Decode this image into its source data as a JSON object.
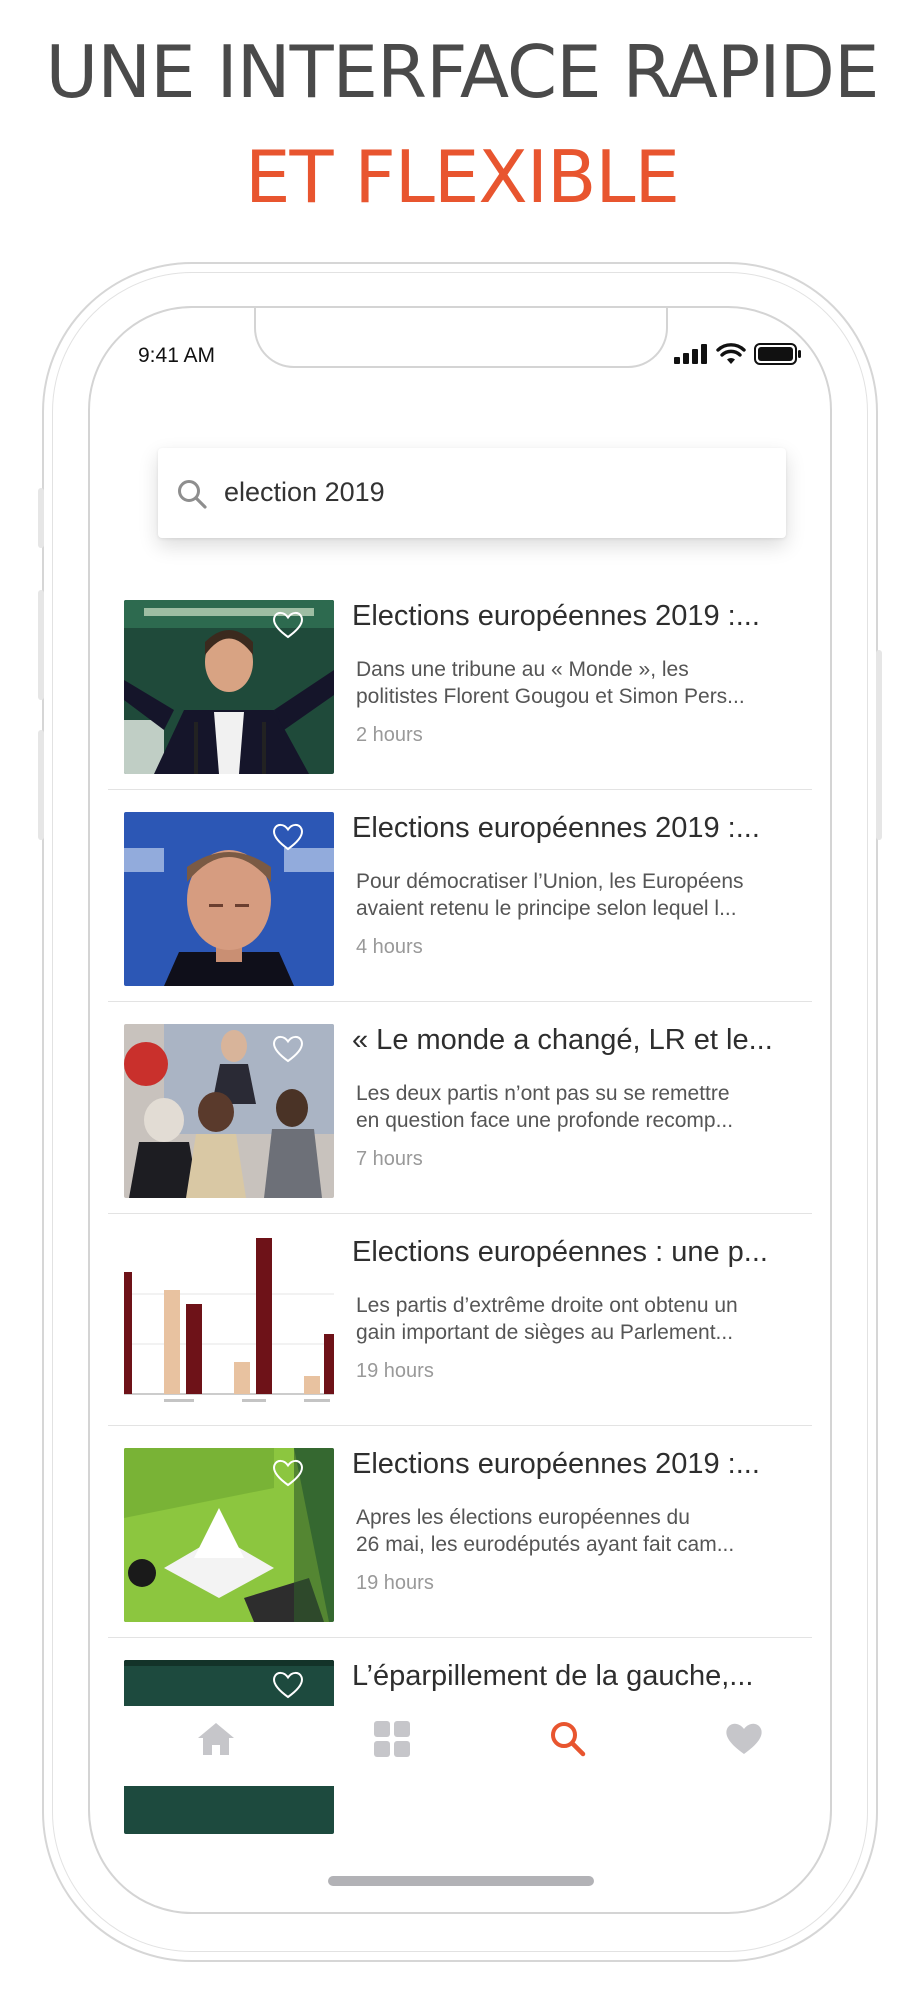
{
  "headline": {
    "line1": "UNE INTERFACE RAPIDE",
    "line2": "ET FLEXIBLE"
  },
  "colors": {
    "accent": "#e8552f",
    "text": "#4a4a4a",
    "inactive_icon": "#c6c6ca"
  },
  "status_bar": {
    "time": "9:41 AM",
    "icons": [
      "signal-icon",
      "wifi-icon",
      "battery-icon"
    ]
  },
  "search": {
    "query": "election 2019",
    "icon": "search-icon"
  },
  "articles": [
    {
      "title": "Elections européennes 2019 :...",
      "desc_line1": "Dans une tribune au « Monde », les",
      "desc_line2": "politistes Florent Gougou et Simon Pers...",
      "ago": "2 hours",
      "thumb": "speaker-photo"
    },
    {
      "title": "Elections européennes 2019 :...",
      "desc_line1": "Pour démocratiser l’Union, les Européens",
      "desc_line2": "avaient retenu le principe selon lequel l...",
      "ago": "4 hours",
      "thumb": "portrait-photo"
    },
    {
      "title": "« Le monde a changé, LR et le...",
      "desc_line1": "Les deux partis n’ont pas su se remettre",
      "desc_line2": "en question face une profonde recomp...",
      "ago": "7 hours",
      "thumb": "crowd-photo"
    },
    {
      "title": "Elections européennes : une p...",
      "desc_line1": "Les partis d’extrême droite ont obtenu un",
      "desc_line2": "gain important de sièges au Parlement...",
      "ago": "19 hours",
      "thumb": "bar-chart-image"
    },
    {
      "title": "Elections européennes 2019 :...",
      "desc_line1": "Apres les élections européennes du",
      "desc_line2": "26 mai, les eurodéputés ayant fait cam...",
      "ago": "19 hours",
      "thumb": "poster-photo"
    },
    {
      "title": "L’éparpillement de la gauche,...",
      "desc_line1": "",
      "desc_line2": "",
      "ago": "",
      "thumb": "dark-green-photo"
    }
  ],
  "tabbar": {
    "tabs": [
      "home-icon",
      "grid-icon",
      "search-icon",
      "heart-icon"
    ],
    "active": "search-icon"
  }
}
